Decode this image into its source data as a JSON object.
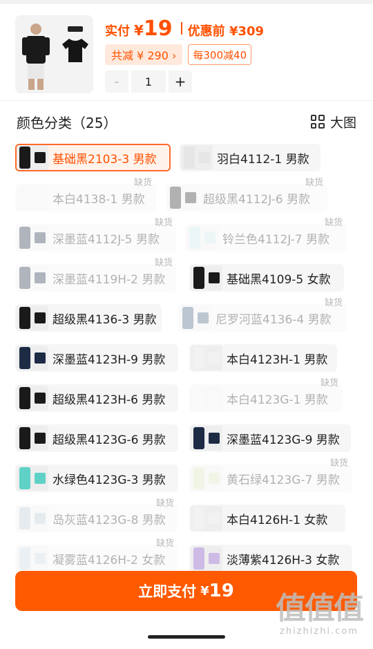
{
  "header": {
    "pay_label": "实付",
    "pay_currency": "¥",
    "pay_amount": "19",
    "before_label": "优惠前 ¥309",
    "save_chip": "共减 ¥ 290 ›",
    "promo_chip": "每300减40",
    "minus": "-",
    "quantity": "1",
    "plus": "+"
  },
  "section": {
    "title": "颜色分类（25）",
    "big_image_label": "大图"
  },
  "options": [
    {
      "label": "基础黑2103-3 男款",
      "selected": true,
      "oos": false
    },
    {
      "label": "羽白4112-1 男款",
      "selected": false,
      "oos": false
    },
    {
      "label": "本白4138-1 男款",
      "selected": false,
      "oos": true
    },
    {
      "label": "超级黑4112J-6 男款",
      "selected": false,
      "oos": true
    },
    {
      "label": "深墨蓝4112J-5 男款",
      "selected": false,
      "oos": true
    },
    {
      "label": "铃兰色4112J-7 男款",
      "selected": false,
      "oos": true
    },
    {
      "label": "深墨蓝4119H-2 男款",
      "selected": false,
      "oos": true
    },
    {
      "label": "基础黑4109-5 女款",
      "selected": false,
      "oos": false
    },
    {
      "label": "超级黑4136-3 男款",
      "selected": false,
      "oos": false
    },
    {
      "label": "尼罗河蓝4136-4 男款",
      "selected": false,
      "oos": true
    },
    {
      "label": "深墨蓝4123H-9 男款",
      "selected": false,
      "oos": false
    },
    {
      "label": "本白4123H-1 男款",
      "selected": false,
      "oos": false
    },
    {
      "label": "超级黑4123H-6 男款",
      "selected": false,
      "oos": false
    },
    {
      "label": "本白4123G-1 男款",
      "selected": false,
      "oos": true
    },
    {
      "label": "超级黑4123G-6 男款",
      "selected": false,
      "oos": false
    },
    {
      "label": "深墨蓝4123G-9 男款",
      "selected": false,
      "oos": false
    },
    {
      "label": "水绿色4123G-3 男款",
      "selected": false,
      "oos": false
    },
    {
      "label": "黄石绿4123G-7 男款",
      "selected": false,
      "oos": true
    },
    {
      "label": "岛灰蓝4123G-8 男款",
      "selected": false,
      "oos": true
    },
    {
      "label": "本白4126H-1 女款",
      "selected": false,
      "oos": false
    },
    {
      "label": "凝雾蓝4126H-2 女款",
      "selected": false,
      "oos": true
    },
    {
      "label": "淡薄紫4126H-3 女款",
      "selected": false,
      "oos": false
    }
  ],
  "oos_label": "缺货",
  "pay_button": {
    "label": "立即支付",
    "currency": "¥",
    "amount": "19"
  },
  "watermark": {
    "top": "值值值",
    "bottom": "zhizhizhi.com"
  },
  "colors": {
    "accent": "#ff5000",
    "button": "#ff5a00"
  }
}
